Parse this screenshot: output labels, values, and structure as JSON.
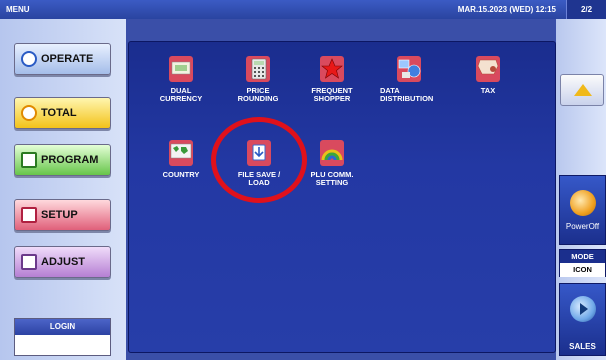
{
  "topbar": {
    "title": "MENU",
    "datetime": "MAR.15.2023 (WED)  12:15",
    "page": "2/2"
  },
  "nav": {
    "operate": "OPERATE",
    "total": "TOTAL",
    "program": "PROGRAM",
    "setup": "SETUP",
    "adjust": "ADJUST",
    "login": "LOGIN"
  },
  "tiles": {
    "dual_currency": {
      "l1": "DUAL",
      "l2": "CURRENCY"
    },
    "price_rounding": {
      "l1": "PRICE",
      "l2": "ROUNDING"
    },
    "frequent_shopper": {
      "l1": "FREQUENT",
      "l2": "SHOPPER"
    },
    "data_distribution": {
      "l1": "DATA",
      "l2": "DISTRIBUTION"
    },
    "tax": {
      "l1": "TAX",
      "l2": ""
    },
    "country": {
      "l1": "COUNTRY",
      "l2": ""
    },
    "file_save_load": {
      "l1": "FILE SAVE /",
      "l2": "LOAD"
    },
    "plu_comm_setting": {
      "l1": "PLU COMM.",
      "l2": "SETTING"
    }
  },
  "right": {
    "poweroff": "PowerOff",
    "mode_label": "MODE",
    "mode_value": "ICON",
    "sales": "SALES"
  },
  "colors": {
    "highlight": "#e0111b",
    "panel": "#2338a3"
  }
}
